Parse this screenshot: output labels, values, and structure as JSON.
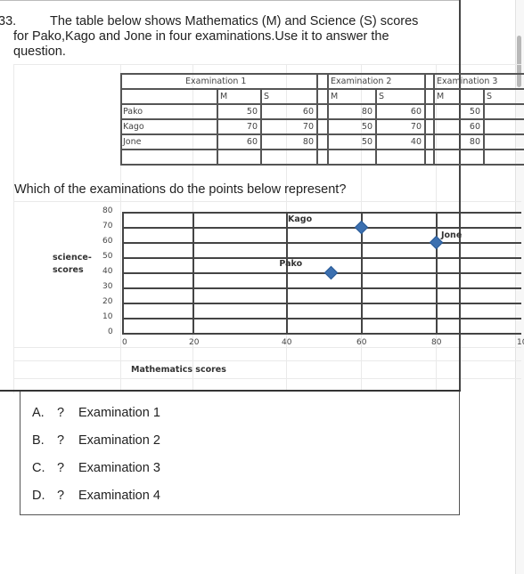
{
  "question": {
    "number": "33.",
    "line1": "The table below shows Mathematics (M) and Science (S) scores",
    "line2": "for Pako,Kago and Jone in four examinations.Use it to answer the",
    "line3": "question.",
    "prompt": "Which of the examinations do the points below represent?"
  },
  "table": {
    "exams": [
      {
        "title": "Examination 1",
        "col_m": "M",
        "col_s": "S",
        "rows": [
          {
            "m": "50",
            "s": "60"
          },
          {
            "m": "70",
            "s": "70"
          },
          {
            "m": "60",
            "s": "80"
          }
        ]
      },
      {
        "title": "Examination 2",
        "col_m": "M",
        "col_s": "S",
        "rows": [
          {
            "m": "80",
            "s": "60"
          },
          {
            "m": "50",
            "s": "70"
          },
          {
            "m": "50",
            "s": "40"
          }
        ]
      },
      {
        "title": "Examination 3",
        "col_m": "M",
        "col_s": "S",
        "rows": [
          {
            "m": "50",
            "s": ""
          },
          {
            "m": "60",
            "s": ""
          },
          {
            "m": "80",
            "s": ""
          }
        ]
      }
    ],
    "students": [
      "Pako",
      "Kago",
      "Jone"
    ]
  },
  "chart_data": {
    "type": "scatter",
    "title": "",
    "xlabel": "Mathematics  scores",
    "ylabel": "science-scores",
    "ylabel_lines": [
      "science-",
      "scores"
    ],
    "xlim": [
      0,
      100
    ],
    "ylim": [
      0,
      80
    ],
    "x_ticks": [
      "0",
      "20",
      "40",
      "60",
      "80",
      "10"
    ],
    "y_ticks": [
      "80",
      "70",
      "60",
      "50",
      "40",
      "30",
      "20",
      "10",
      "0"
    ],
    "grid": true,
    "marker": "diamond",
    "marker_color": "#3c70b0",
    "points": [
      {
        "label": "Kago",
        "x": 60,
        "y": 70
      },
      {
        "label": "Jone",
        "x": 80,
        "y": 60
      },
      {
        "label": "Pako",
        "x": 52,
        "y": 40
      }
    ]
  },
  "options": [
    {
      "letter": "A.",
      "mark": "?",
      "text": "Examination 1"
    },
    {
      "letter": "B.",
      "mark": "?",
      "text": "Examination 2"
    },
    {
      "letter": "C.",
      "mark": "?",
      "text": "Examination 3"
    },
    {
      "letter": "D.",
      "mark": "?",
      "text": "Examination 4"
    }
  ]
}
